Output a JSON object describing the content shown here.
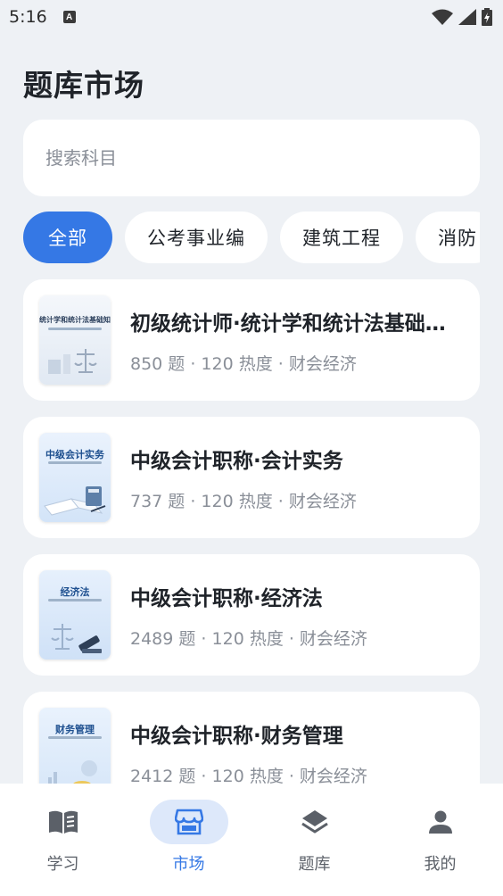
{
  "status_bar": {
    "time": "5:16",
    "notification_icon": "A"
  },
  "page": {
    "title": "题库市场"
  },
  "search": {
    "placeholder": "搜索科目",
    "value": ""
  },
  "categories": [
    {
      "label": "全部",
      "selected": true
    },
    {
      "label": "公考事业编",
      "selected": false
    },
    {
      "label": "建筑工程",
      "selected": false
    },
    {
      "label": "消防",
      "selected": false
    }
  ],
  "question_banks": [
    {
      "title": "初级统计师·统计学和统计法基础知识",
      "meta": "850 题 · 120 热度 · 财会经济",
      "cover_text": "统计学和统计法基础知识"
    },
    {
      "title": "中级会计职称·会计实务",
      "meta": "737 题 · 120 热度 · 财会经济",
      "cover_text": "中级会计实务"
    },
    {
      "title": "中级会计职称·经济法",
      "meta": "2489 题 · 120 热度 · 财会经济",
      "cover_text": "经济法"
    },
    {
      "title": "中级会计职称·财务管理",
      "meta": "2412 题 · 120 热度 · 财会经济",
      "cover_text": "财务管理"
    }
  ],
  "bottom_nav": [
    {
      "label": "学习",
      "icon": "book-icon",
      "active": false
    },
    {
      "label": "市场",
      "icon": "store-icon",
      "active": true
    },
    {
      "label": "题库",
      "icon": "layers-icon",
      "active": false
    },
    {
      "label": "我的",
      "icon": "person-icon",
      "active": false
    }
  ],
  "colors": {
    "accent": "#3578e5",
    "background": "#eef1f5",
    "active_nav_bg": "#dde8fa"
  }
}
